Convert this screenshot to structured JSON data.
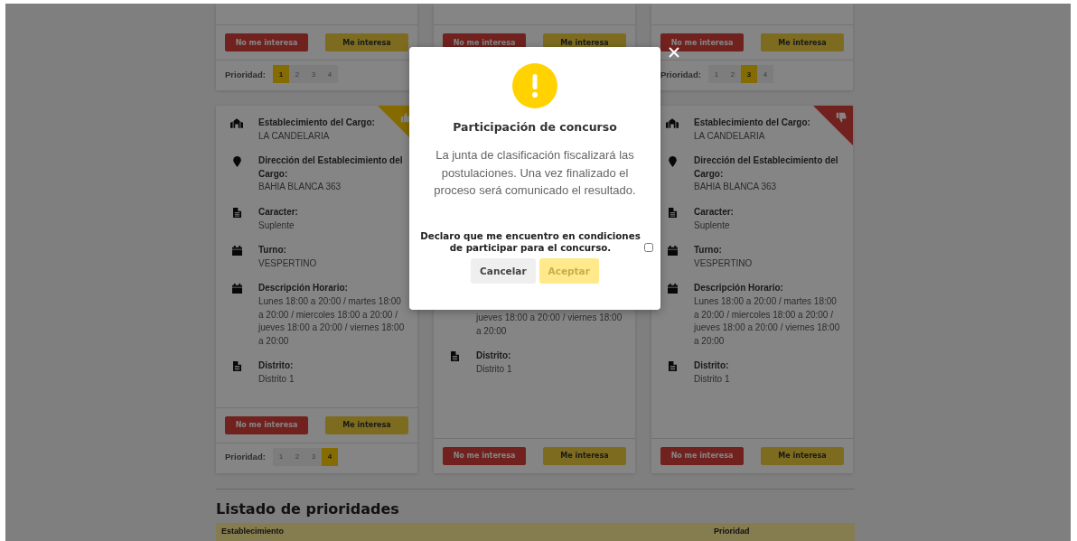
{
  "card_rows": [
    {
      "cards": [
        {
          "kind": "plain",
          "buttons": [
            "No me interesa",
            "Me interesa"
          ],
          "priority": {
            "label": "Prioridad:",
            "options": [
              {
                "label": "1",
                "selected": true
              },
              {
                "label": "2",
                "selected": false
              },
              {
                "label": "3",
                "selected": false
              },
              {
                "label": "4",
                "selected": false
              }
            ]
          }
        },
        {
          "kind": "plain",
          "buttons": [
            "No me interesa",
            "Me interesa"
          ]
        },
        {
          "kind": "plain",
          "buttons": [
            "No me interesa",
            "Me interesa"
          ],
          "priority": {
            "label": "Prioridad:",
            "options": [
              {
                "label": "1",
                "selected": false
              },
              {
                "label": "2",
                "selected": false
              },
              {
                "label": "3",
                "selected": true
              },
              {
                "label": "4",
                "selected": false
              }
            ]
          }
        }
      ]
    },
    {
      "cards": [
        {
          "kind": "liked",
          "fields": [
            {
              "kind": "building",
              "label": "Establecimiento del Cargo:",
              "value": "LA CANDELARIA"
            },
            {
              "kind": "address",
              "label": "Dirección del Establecimiento del Cargo:",
              "value": "BAHIA BLANCA 363"
            },
            {
              "kind": "document",
              "label": "Caracter:",
              "value": "Suplente"
            },
            {
              "kind": "schedule",
              "label": "Turno:",
              "value": "VESPERTINO"
            },
            {
              "kind": "schedule",
              "label": "Descripción Horario:",
              "value": "Lunes 18:00 a 20:00 / martes 18:00 a 20:00 / miercoles 18:00 a 20:00 / jueves 18:00 a 20:00 / viernes 18:00 a 20:00"
            },
            {
              "kind": "document",
              "label": "Distrito:",
              "value": "Distrito 1"
            }
          ],
          "buttons": [
            "No me interesa",
            "Me interesa"
          ],
          "priority": {
            "label": "Prioridad:",
            "options": [
              {
                "label": "1",
                "selected": false
              },
              {
                "label": "2",
                "selected": false
              },
              {
                "label": "3",
                "selected": false
              },
              {
                "label": "4",
                "selected": true
              }
            ]
          }
        },
        {
          "kind": "partial",
          "fields": [
            {
              "kind": "continued",
              "value": "jueves 18:00 a 20:00 / viernes 18:00 a 20:00"
            },
            {
              "kind": "document",
              "label": "Distrito:",
              "value": "Distrito 1"
            }
          ],
          "buttons": [
            "No me interesa",
            "Me interesa"
          ]
        },
        {
          "kind": "disliked",
          "fields": [
            {
              "kind": "building",
              "label": "Establecimiento del Cargo:",
              "value": "LA CANDELARIA"
            },
            {
              "kind": "address",
              "label": "Dirección del Establecimiento del Cargo:",
              "value": "BAHIA BLANCA 363"
            },
            {
              "kind": "document",
              "label": "Caracter:",
              "value": "Suplente"
            },
            {
              "kind": "schedule",
              "label": "Turno:",
              "value": "VESPERTINO"
            },
            {
              "kind": "schedule",
              "label": "Descripción Horario:",
              "value": "Lunes 18:00 a 20:00 / martes 18:00 a 20:00 / miercoles 18:00 a 20:00 / jueves 18:00 a 20:00 / viernes 18:00 a 20:00"
            },
            {
              "kind": "document",
              "label": "Distrito:",
              "value": "Distrito 1"
            }
          ],
          "buttons": [
            "No me interesa",
            "Me interesa"
          ]
        }
      ]
    }
  ],
  "priority_list": {
    "title": "Listado de prioridades",
    "columns": [
      "Establecimiento",
      "Prioridad"
    ]
  },
  "modal": {
    "title": "Participación de concurso",
    "message": "La junta de clasificación fiscalizará las postulaciones. Una vez finalizado el proceso será comunicado el resultado.",
    "declaration": "Declaro que me encuentro en condiciones de participar para el concurso.",
    "checked": false,
    "buttons": [
      {
        "label": "Cancelar",
        "disabled": false
      },
      {
        "label": "Aceptar",
        "disabled": true
      }
    ]
  }
}
